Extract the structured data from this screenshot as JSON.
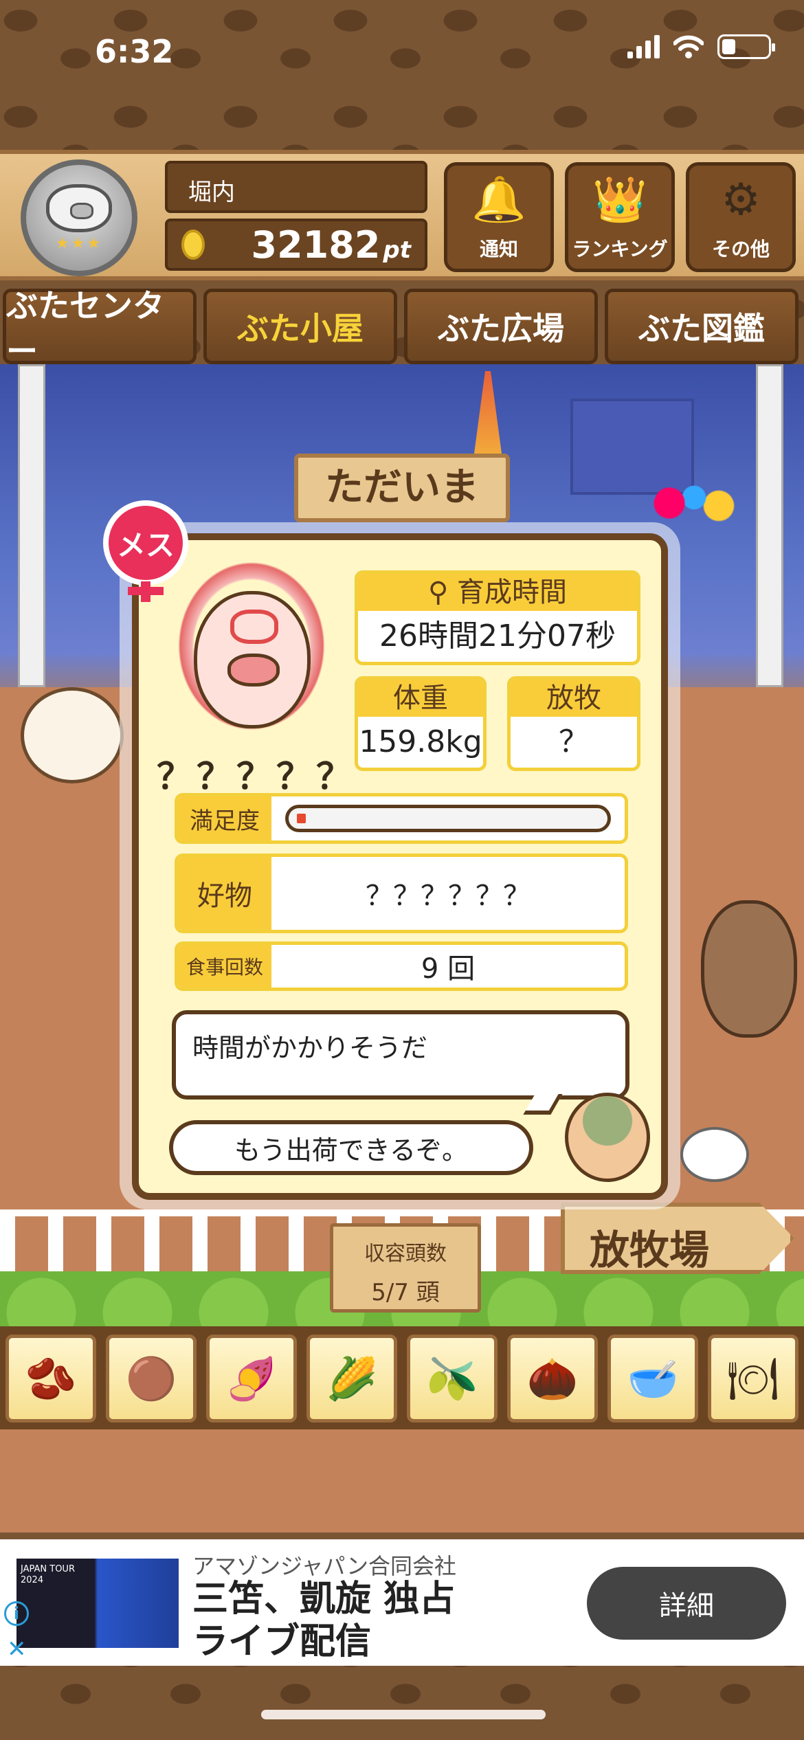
{
  "status_bar": {
    "time": "6:32"
  },
  "header": {
    "user_name": "堀内",
    "points": "32182",
    "points_unit": "pt",
    "buttons": [
      {
        "label": "通知",
        "icon": "bell-icon"
      },
      {
        "label": "ランキング",
        "icon": "crown-icon"
      },
      {
        "label": "その他",
        "icon": "gear-icon"
      }
    ]
  },
  "tabs": [
    {
      "label": "ぶたセンター",
      "active": false
    },
    {
      "label": "ぶた小屋",
      "active": true
    },
    {
      "label": "ぶた広場",
      "active": false
    },
    {
      "label": "ぶた図鑑",
      "active": false
    }
  ],
  "scene": {
    "sign": "ただいま"
  },
  "pig_detail": {
    "gender": "メス",
    "name": "？？？？？",
    "growth_time_label": "育成時間",
    "growth_time": "26時間21分07秒",
    "weight_label": "体重",
    "weight": "159.8kg",
    "grazing_label": "放牧",
    "grazing": "？",
    "satisfaction_label": "満足度",
    "satisfaction_level": 0.03,
    "favorite_label": "好物",
    "favorite": "？？？？？？",
    "meals_label": "食事回数",
    "meals": "9 回",
    "comment": "時間がかかりそうだ",
    "farmer_comment": "もう出荷できるぞ。"
  },
  "capacity": {
    "label": "収容頭数",
    "value": "5/7 頭"
  },
  "pasture_sign": "放牧場",
  "feeds": [
    {
      "icon": "beans-icon"
    },
    {
      "icon": "mixed-beans-icon"
    },
    {
      "icon": "sweet-potato-icon"
    },
    {
      "icon": "corn-icon"
    },
    {
      "icon": "berries-icon"
    },
    {
      "icon": "acorn-icon"
    },
    {
      "icon": "grain-plate-icon"
    },
    {
      "icon": "truffle-plate-icon"
    }
  ],
  "ad": {
    "advertiser": "アマゾンジャパン合同会社",
    "title": "三笘、凱旋 独占ライブ配信",
    "button": "詳細",
    "thumb_text": "JAPAN TOUR 2024"
  },
  "colors": {
    "tab_active_text": "#f7d33a",
    "gender_badge": "#e8305a",
    "stat_header": "#f9cd3a",
    "satisfaction_fill": "#e64a2e"
  }
}
